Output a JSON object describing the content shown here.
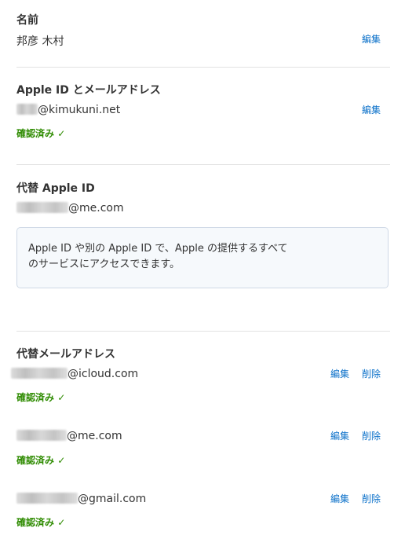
{
  "name_section": {
    "heading": "名前",
    "value": "邦彦 木村",
    "edit_label": "編集"
  },
  "apple_id_section": {
    "heading": "Apple ID とメールアドレス",
    "email_suffix": "@kimukuni.net",
    "edit_label": "編集",
    "verified_label": "確認済み",
    "verified_icon": "checkmark-icon"
  },
  "alt_apple_id_section": {
    "heading": "代替 Apple ID",
    "email_suffix": "@me.com",
    "info_line1": "Apple ID や別の Apple ID で、Apple の提供するすべて",
    "info_line2": "のサービスにアクセスできます。"
  },
  "alt_email_section": {
    "heading": "代替メールアドレス",
    "emails": [
      {
        "suffix": "@icloud.com",
        "edit_label": "編集",
        "delete_label": "削除",
        "verified_label": "確認済み"
      },
      {
        "suffix": "@me.com",
        "edit_label": "編集",
        "delete_label": "削除",
        "verified_label": "確認済み"
      },
      {
        "suffix": "@gmail.com",
        "edit_label": "編集",
        "delete_label": "削除",
        "verified_label": "確認済み"
      }
    ]
  },
  "colors": {
    "link": "#0a70c9",
    "verified": "#2e8b00",
    "divider": "#e2e2e2"
  }
}
